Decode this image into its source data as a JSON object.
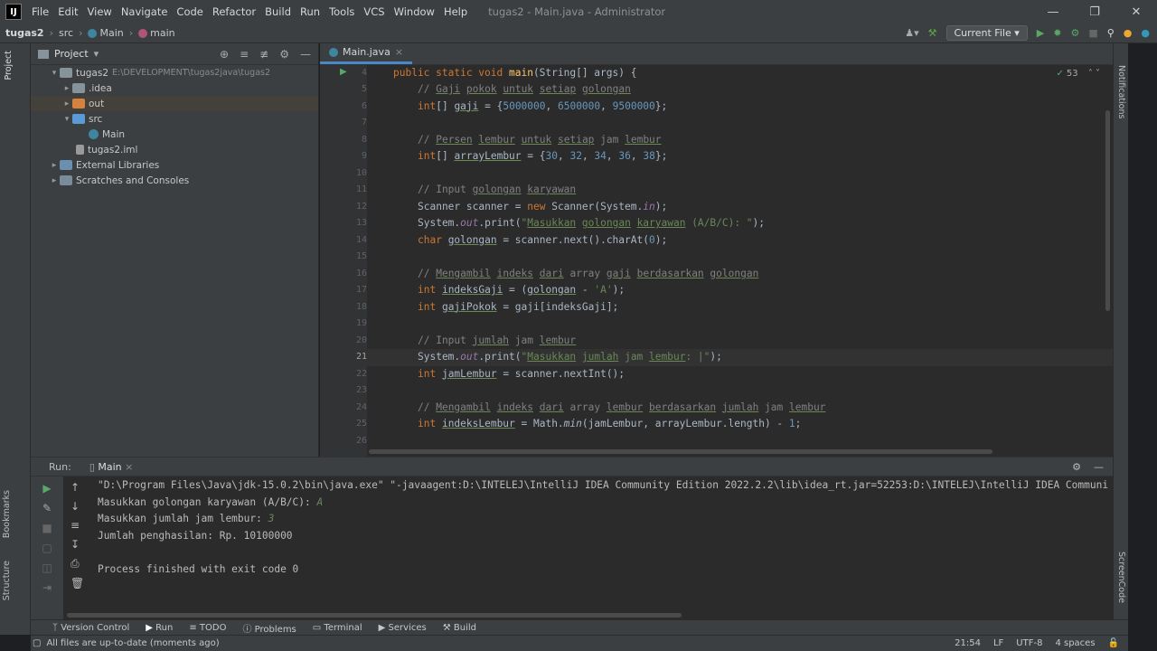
{
  "titlebar": {
    "menu": [
      "File",
      "Edit",
      "View",
      "Navigate",
      "Code",
      "Refactor",
      "Build",
      "Run",
      "Tools",
      "VCS",
      "Window",
      "Help"
    ],
    "title": "tugas2 - Main.java - Administrator"
  },
  "navbar": {
    "project": "tugas2",
    "src": "src",
    "cls": "Main",
    "method": "main",
    "run_config": "Current File"
  },
  "project": {
    "title": "Project",
    "tree": [
      {
        "label": "tugas2",
        "path": "E:\\DEVELOPMENT\\tugas2java\\tugas2"
      },
      {
        "label": ".idea"
      },
      {
        "label": "out"
      },
      {
        "label": "src"
      },
      {
        "label": "Main"
      },
      {
        "label": "tugas2.iml"
      },
      {
        "label": "External Libraries"
      },
      {
        "label": "Scratches and Consoles"
      }
    ]
  },
  "editor": {
    "tab": "Main.java",
    "warnings": "53",
    "line_numbers": [
      "4",
      "5",
      "6",
      "7",
      "8",
      "9",
      "10",
      "11",
      "12",
      "13",
      "14",
      "15",
      "16",
      "17",
      "18",
      "19",
      "20",
      "21",
      "22",
      "23",
      "24",
      "25",
      "26"
    ]
  },
  "run": {
    "label": "Run:",
    "tab": "Main",
    "lines": {
      "cmd": "\"D:\\Program Files\\Java\\jdk-15.0.2\\bin\\java.exe\" \"-javaagent:D:\\INTELEJ\\IntelliJ IDEA Community Edition 2022.2.2\\lib\\idea_rt.jar=52253:D:\\INTELEJ\\IntelliJ IDEA Communi",
      "p1": "Masukkan golongan karyawan (A/B/C): ",
      "i1": "A",
      "p2": "Masukkan jumlah jam lembur: ",
      "i2": "3",
      "res": "Jumlah penghasilan: Rp. 10100000",
      "fin": "Process finished with exit code 0"
    }
  },
  "toolwindows": {
    "items": [
      "Version Control",
      "Run",
      "TODO",
      "Problems",
      "Terminal",
      "Services",
      "Build"
    ]
  },
  "side": {
    "project": "Project",
    "bookmarks": "Bookmarks",
    "structure": "Structure",
    "notifications": "Notifications",
    "screencode": "ScreenCode"
  },
  "status": {
    "msg": "All files are up-to-date (moments ago)",
    "pos": "21:54",
    "lf": "LF",
    "enc": "UTF-8",
    "indent": "4 spaces"
  }
}
